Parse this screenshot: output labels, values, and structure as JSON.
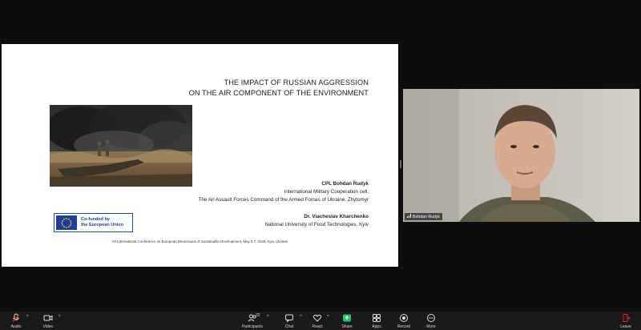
{
  "slide": {
    "title_line1": "THE IMPACT OF RUSSIAN AGGRESSION",
    "title_line2": "ON THE AIR COMPONENT OF THE ENVIRONMENT",
    "presenter_name": "CPL Bohdan Rudyk",
    "presenter_role": "International Military Cooperation cell,",
    "presenter_org": "The Air Assault Forces Command of the Armed Forces of Ukraine, Zhytomyr",
    "coauthor_name": "Dr. Viacheslav Kharchenko",
    "coauthor_org": "National University of Food Technologies, Kyiv",
    "eu_line1": "Co-funded by",
    "eu_line2": "the European Union",
    "conference": "VII International Conference on European Dimensions of Sustainable Development, May 5-7, 2025, Kyiv, Ukraine"
  },
  "video": {
    "participant_name": "Bohdan Rudyk"
  },
  "toolbar": {
    "audio": "Audio",
    "video": "Video",
    "participants": "Participants",
    "participants_count": "32",
    "chat": "Chat",
    "react": "React",
    "share": "Share",
    "apps": "Apps",
    "record": "Record",
    "more": "More",
    "leave": "Leave",
    "share_color": "#22c55e",
    "leave_color": "#e02424"
  }
}
